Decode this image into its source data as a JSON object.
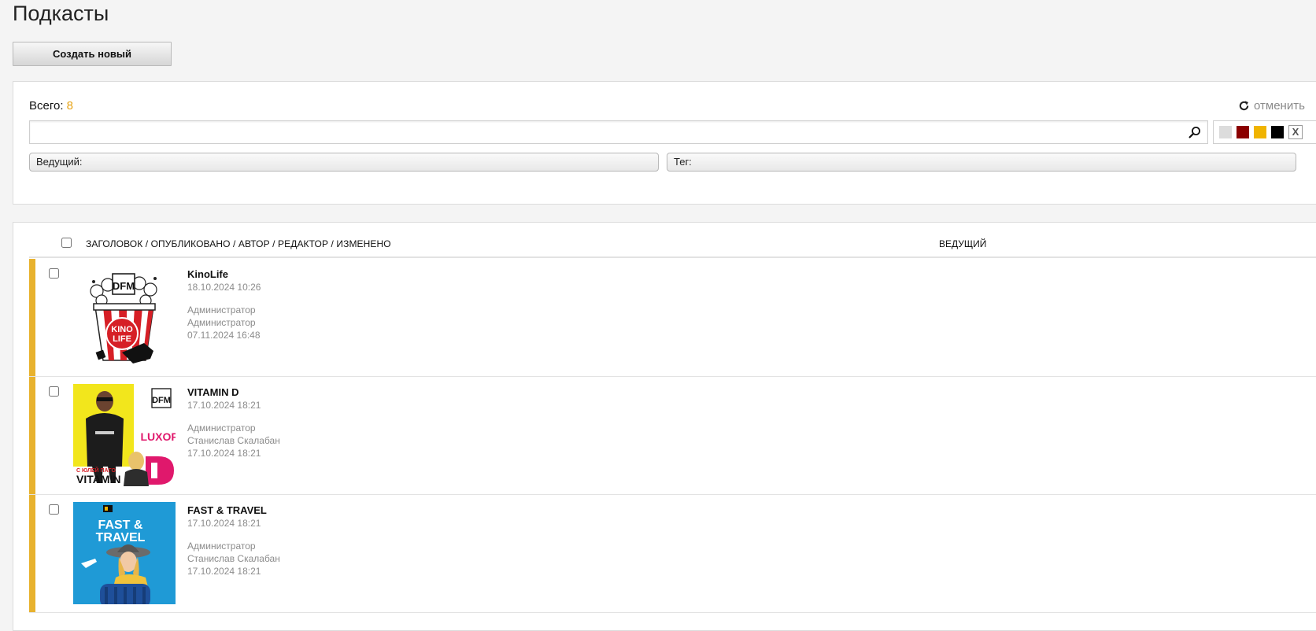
{
  "page": {
    "title": "Подкасты"
  },
  "toolbar": {
    "create_label": "Создать новый"
  },
  "filters": {
    "total_label": "Всего:",
    "total_count": "8",
    "reset_label": "отменить",
    "search": {
      "value": "",
      "placeholder": ""
    },
    "color_swatches": [
      "#dcdcdc",
      "#8b0000",
      "#f0b400",
      "#000000"
    ],
    "clear_label": "X",
    "host_label": "Ведущий:",
    "tag_label": "Тег:"
  },
  "list": {
    "columns": {
      "main": "ЗАГОЛОВОК / ОПУБЛИКОВАНО / АВТОР / РЕДАКТОР / ИЗМЕНЕНО",
      "host": "ВЕДУЩИЙ"
    },
    "rows": [
      {
        "title": "KinoLife",
        "published": "18.10.2024 10:26",
        "author": "Администратор",
        "editor": "Администратор",
        "modified": "07.11.2024 16:48",
        "thumb_logo": "DFM",
        "thumb_text_1": "KINO",
        "thumb_text_2": "LIFE"
      },
      {
        "title": "VITAMIN D",
        "published": "17.10.2024 18:21",
        "author": "Администратор",
        "editor": "Станислав Скалабан",
        "modified": "17.10.2024 18:21",
        "thumb_logo": "DFM",
        "thumb_small": "С ЮЛЕЙ ПАГО",
        "thumb_text_1": "VITAMIN",
        "thumb_text_2": "LUXOR",
        "thumb_text_3": "D"
      },
      {
        "title": "FAST & TRAVEL",
        "published": "17.10.2024 18:21",
        "author": "Администратор",
        "editor": "Станислав Скалабан",
        "modified": "17.10.2024 18:21",
        "thumb_text_1": "FAST &",
        "thumb_text_2": "TRAVEL"
      }
    ]
  }
}
